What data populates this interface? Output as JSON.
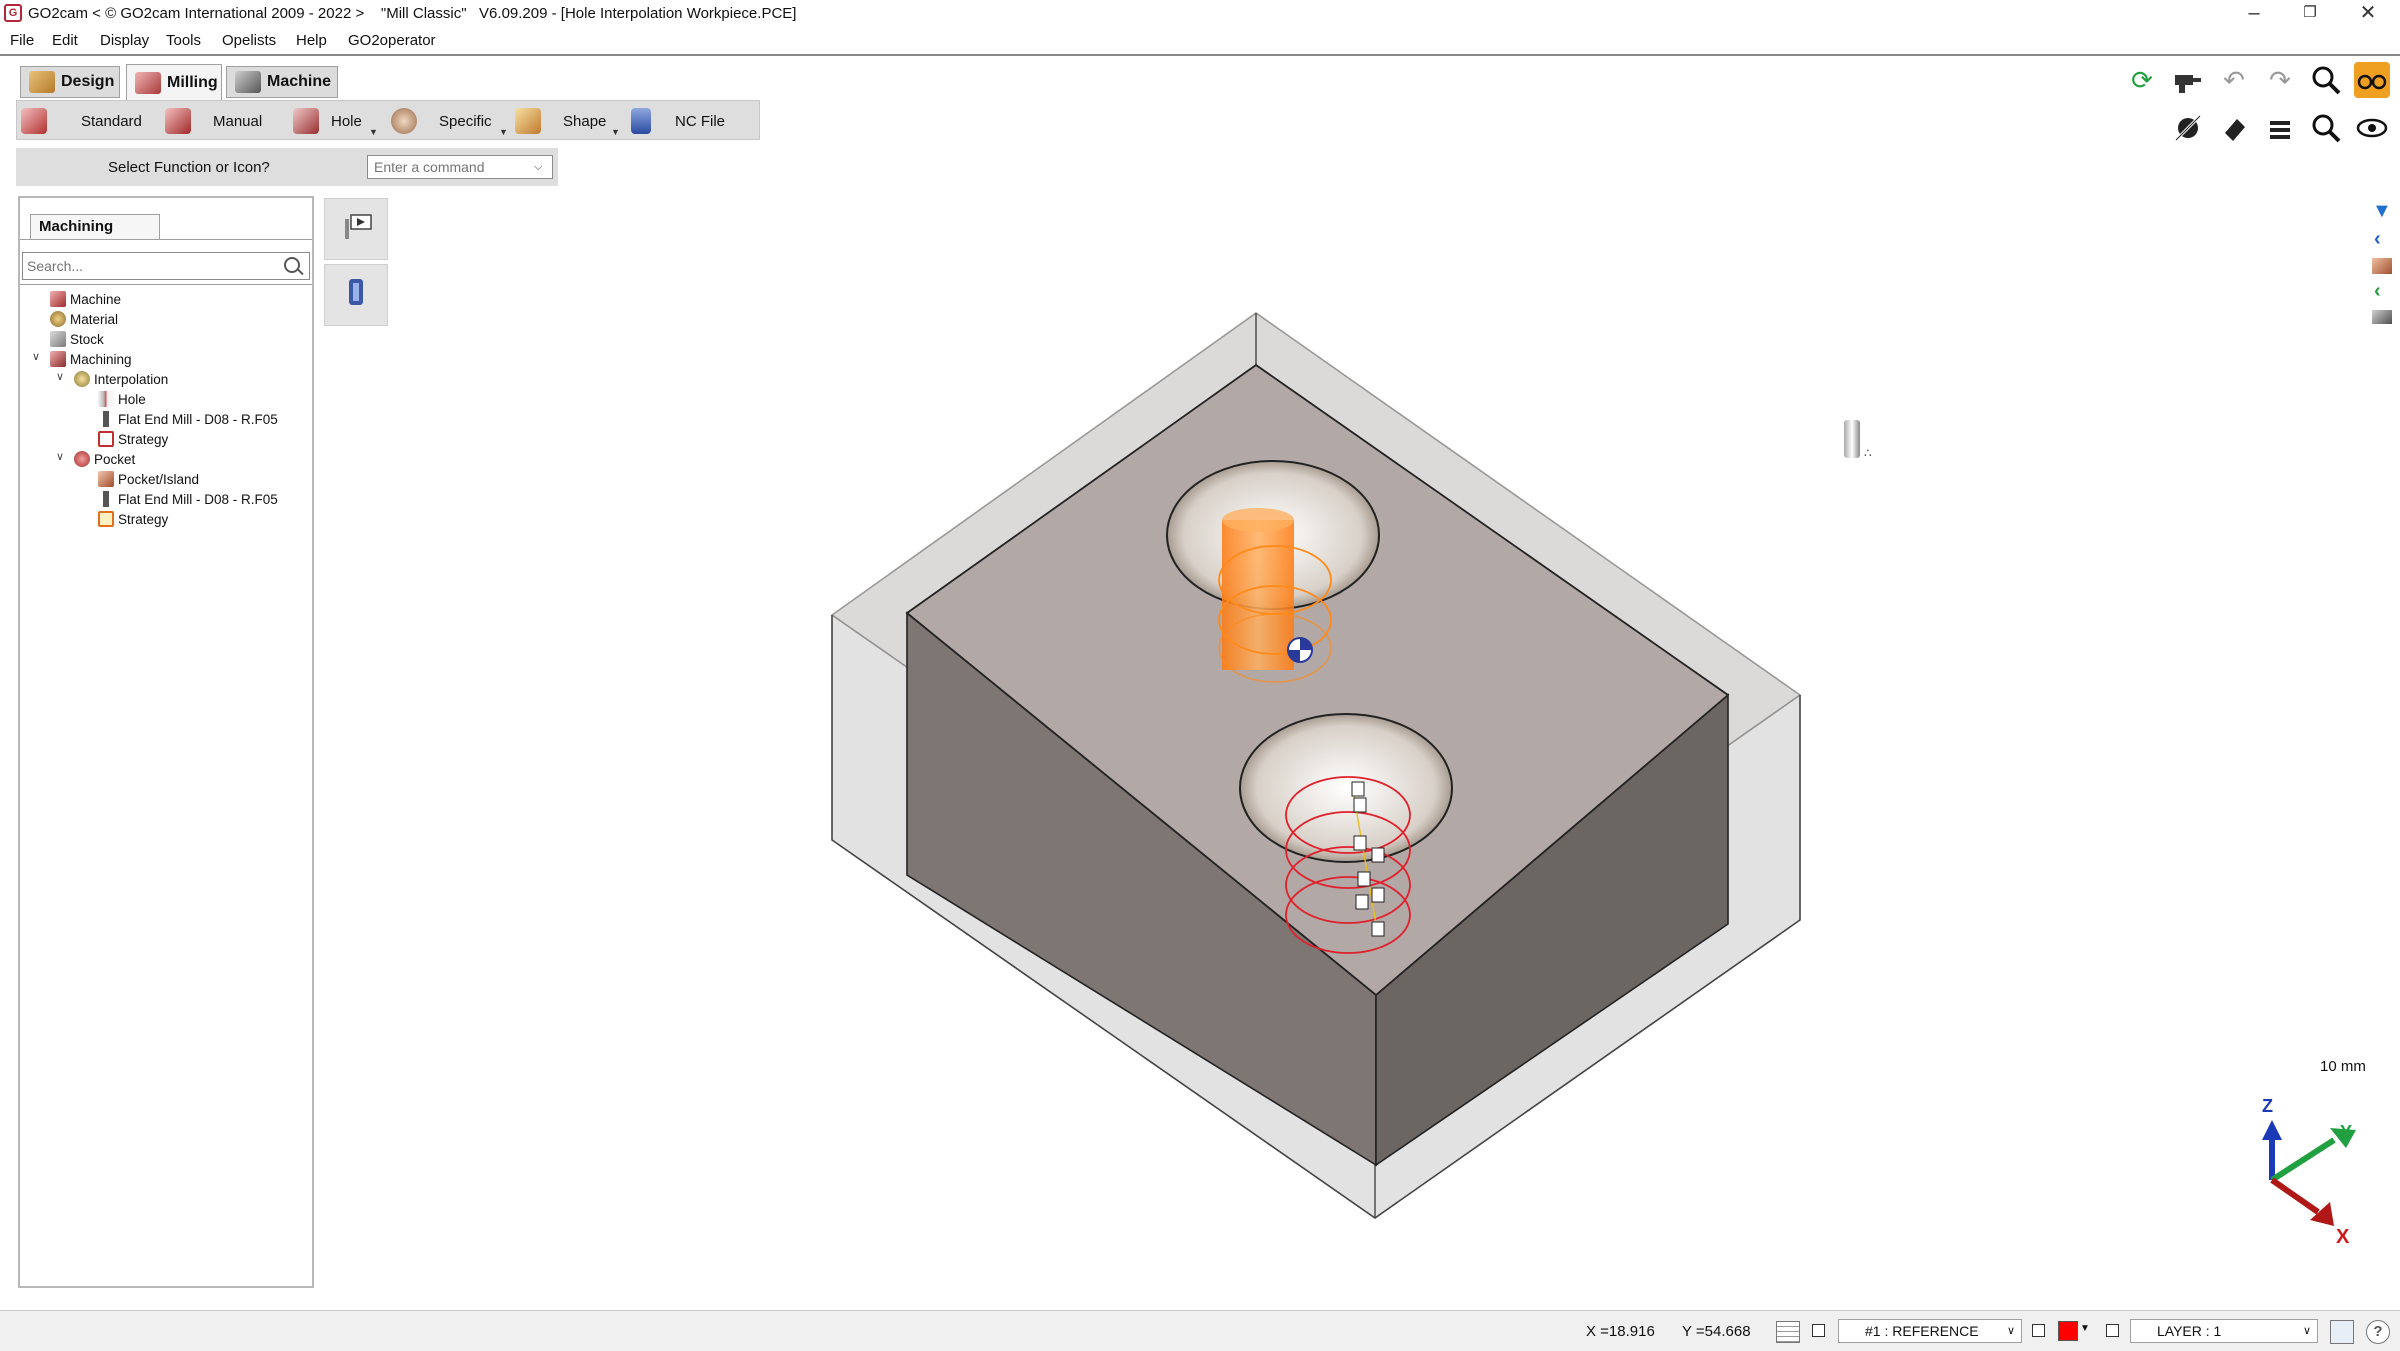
{
  "window": {
    "title": "GO2cam < © GO2cam International 2009 - 2022 >    \"Mill Classic\"   V6.09.209 - [Hole Interpolation Workpiece.PCE]",
    "logo_icon": "go2cam-logo-icon",
    "minimize_icon": "minimize-icon",
    "restore_icon": "restore-icon",
    "close_icon": "close-icon"
  },
  "menu": [
    "File",
    "Edit",
    "Display",
    "Tools",
    "Opelists",
    "Help",
    "GO2operator"
  ],
  "module_tabs": [
    {
      "label": "Design",
      "icon": "design-icon",
      "active": false
    },
    {
      "label": "Milling",
      "icon": "milling-icon",
      "active": true
    },
    {
      "label": "Machine",
      "icon": "machine-icon",
      "active": false
    }
  ],
  "functions": [
    {
      "label": "Standard",
      "icon": "standard-icon",
      "dropdown": false
    },
    {
      "label": "Manual",
      "icon": "manual-icon",
      "dropdown": false
    },
    {
      "label": "Hole",
      "icon": "hole-icon",
      "dropdown": true
    },
    {
      "label": "Specific",
      "icon": "specific-icon",
      "dropdown": true
    },
    {
      "label": "Shape",
      "icon": "shape-icon",
      "dropdown": true
    },
    {
      "label": "NC File",
      "icon": "nc-file-icon",
      "dropdown": false
    }
  ],
  "command": {
    "label": "Select Function or Icon?",
    "placeholder": "Enter a command"
  },
  "panel": {
    "tab": "Machining",
    "search_placeholder": "Search...",
    "tree": [
      {
        "label": "Machine",
        "icon": "machine-node-icon",
        "level": 1
      },
      {
        "label": "Material",
        "icon": "material-icon",
        "level": 1
      },
      {
        "label": "Stock",
        "icon": "stock-icon",
        "level": 1
      },
      {
        "label": "Machining",
        "icon": "machining-icon",
        "level": 1,
        "expanded": true
      },
      {
        "label": "Interpolation",
        "icon": "interpolation-icon",
        "level": 2,
        "expanded": true
      },
      {
        "label": "Hole",
        "icon": "hole-geometry-icon",
        "level": 3
      },
      {
        "label": "Flat End Mill - D08 - R.F05",
        "icon": "flat-end-mill-icon",
        "level": 3
      },
      {
        "label": "Strategy",
        "icon": "strategy-icon",
        "level": 3
      },
      {
        "label": "Pocket",
        "icon": "pocket-icon",
        "level": 2,
        "expanded": true
      },
      {
        "label": "Pocket/Island",
        "icon": "pocket-island-icon",
        "level": 3
      },
      {
        "label": "Flat End Mill - D08 - R.F05",
        "icon": "flat-end-mill-icon",
        "level": 3
      },
      {
        "label": "Strategy",
        "icon": "strategy-icon",
        "level": 3
      }
    ]
  },
  "side_buttons": [
    "simulation-play-icon",
    "tool-icon"
  ],
  "view_tools_row1": [
    "regenerate-icon",
    "drill-icon",
    "undo-icon",
    "redo-icon",
    "zoom-icon",
    "glasses-icon"
  ],
  "view_tools_row2": [
    "hide-entities-icon",
    "eraser-icon",
    "layers-icon",
    "zoom-window-icon",
    "visibility-icon"
  ],
  "right_strip": [
    "filter-icon",
    "collapse-left-icon",
    "part-icon",
    "collapse-left-green-icon",
    "stock-view-icon"
  ],
  "viewport": {
    "scale_label": "10 mm",
    "axis_labels": {
      "x": "X",
      "y": "Y",
      "z": "Z"
    },
    "tool_marker": "tool-cursor-icon",
    "colors": {
      "tool": "#ff8a1a",
      "toolpath": "#e0202a",
      "solid": "#8a827e",
      "stock": "#c8c8c8"
    }
  },
  "status": {
    "x": "X =18.916",
    "y": "Y =54.668",
    "reference": "#1 : REFERENCE",
    "layer": "LAYER :  1",
    "active_color": "#ff0000"
  }
}
